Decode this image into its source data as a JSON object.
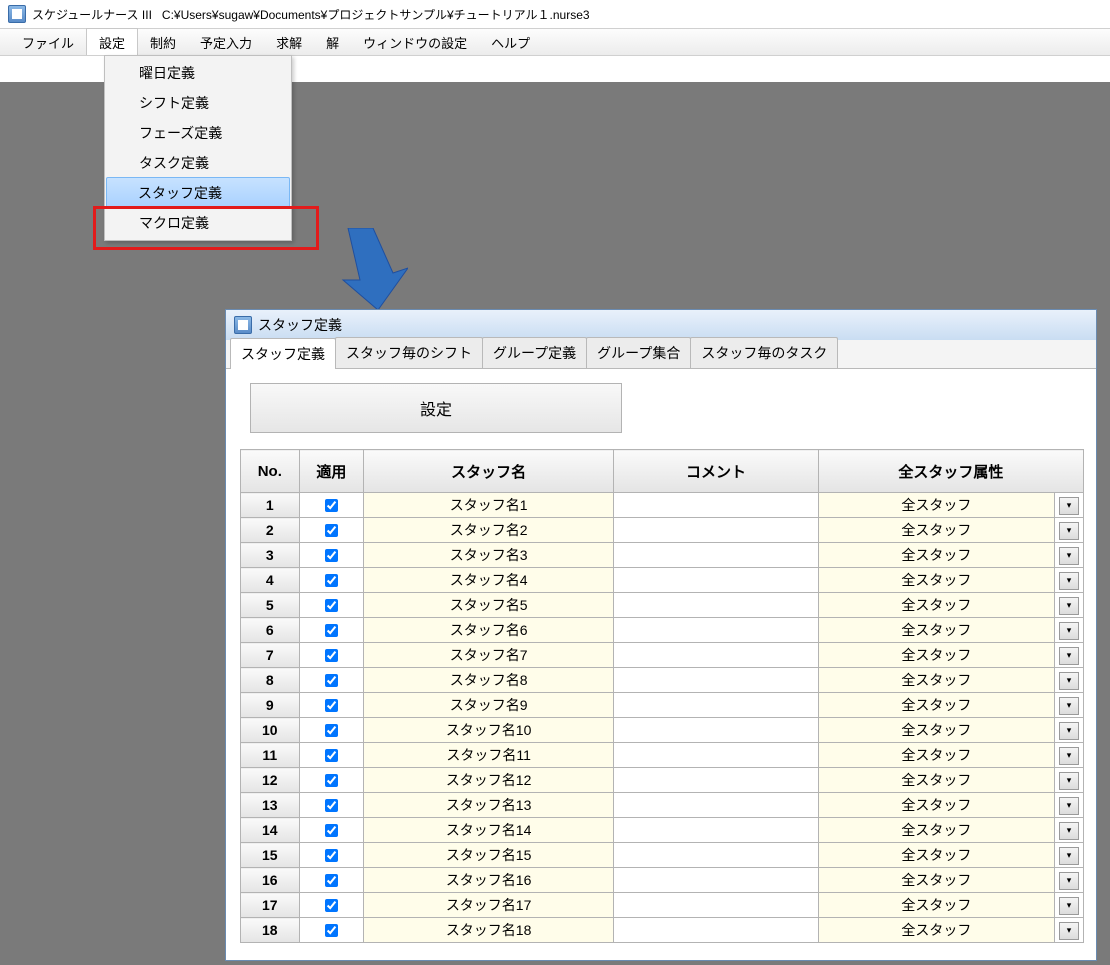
{
  "title": {
    "app": "スケジュールナース III",
    "path": "C:¥Users¥sugaw¥Documents¥プロジェクトサンプル¥チュートリアル１.nurse3"
  },
  "menu": {
    "file": "ファイル",
    "settings": "設定",
    "constraint": "制約",
    "input": "予定入力",
    "solve": "求解",
    "solution": "解",
    "window": "ウィンドウの設定",
    "help": "ヘルプ"
  },
  "dropdown": [
    {
      "label": "曜日定義"
    },
    {
      "label": "シフト定義"
    },
    {
      "label": "フェーズ定義"
    },
    {
      "label": "タスク定義"
    },
    {
      "label": "スタッフ定義",
      "hover": true
    },
    {
      "label": "マクロ定義"
    }
  ],
  "child": {
    "title": "スタッフ定義",
    "tabs": [
      "スタッフ定義",
      "スタッフ毎のシフト",
      "グループ定義",
      "グループ集合",
      "スタッフ毎のタスク"
    ],
    "button": "設定",
    "headers": {
      "no": "No.",
      "apply": "適用",
      "name": "スタッフ名",
      "comment": "コメント",
      "attr": "全スタッフ属性"
    },
    "rows": [
      {
        "no": "1",
        "apply": true,
        "name": "スタッフ名1",
        "comment": "",
        "attr": "全スタッフ"
      },
      {
        "no": "2",
        "apply": true,
        "name": "スタッフ名2",
        "comment": "",
        "attr": "全スタッフ"
      },
      {
        "no": "3",
        "apply": true,
        "name": "スタッフ名3",
        "comment": "",
        "attr": "全スタッフ"
      },
      {
        "no": "4",
        "apply": true,
        "name": "スタッフ名4",
        "comment": "",
        "attr": "全スタッフ"
      },
      {
        "no": "5",
        "apply": true,
        "name": "スタッフ名5",
        "comment": "",
        "attr": "全スタッフ"
      },
      {
        "no": "6",
        "apply": true,
        "name": "スタッフ名6",
        "comment": "",
        "attr": "全スタッフ"
      },
      {
        "no": "7",
        "apply": true,
        "name": "スタッフ名7",
        "comment": "",
        "attr": "全スタッフ"
      },
      {
        "no": "8",
        "apply": true,
        "name": "スタッフ名8",
        "comment": "",
        "attr": "全スタッフ"
      },
      {
        "no": "9",
        "apply": true,
        "name": "スタッフ名9",
        "comment": "",
        "attr": "全スタッフ"
      },
      {
        "no": "10",
        "apply": true,
        "name": "スタッフ名10",
        "comment": "",
        "attr": "全スタッフ"
      },
      {
        "no": "11",
        "apply": true,
        "name": "スタッフ名11",
        "comment": "",
        "attr": "全スタッフ"
      },
      {
        "no": "12",
        "apply": true,
        "name": "スタッフ名12",
        "comment": "",
        "attr": "全スタッフ"
      },
      {
        "no": "13",
        "apply": true,
        "name": "スタッフ名13",
        "comment": "",
        "attr": "全スタッフ"
      },
      {
        "no": "14",
        "apply": true,
        "name": "スタッフ名14",
        "comment": "",
        "attr": "全スタッフ"
      },
      {
        "no": "15",
        "apply": true,
        "name": "スタッフ名15",
        "comment": "",
        "attr": "全スタッフ"
      },
      {
        "no": "16",
        "apply": true,
        "name": "スタッフ名16",
        "comment": "",
        "attr": "全スタッフ"
      },
      {
        "no": "17",
        "apply": true,
        "name": "スタッフ名17",
        "comment": "",
        "attr": "全スタッフ"
      },
      {
        "no": "18",
        "apply": true,
        "name": "スタッフ名18",
        "comment": "",
        "attr": "全スタッフ"
      }
    ]
  }
}
